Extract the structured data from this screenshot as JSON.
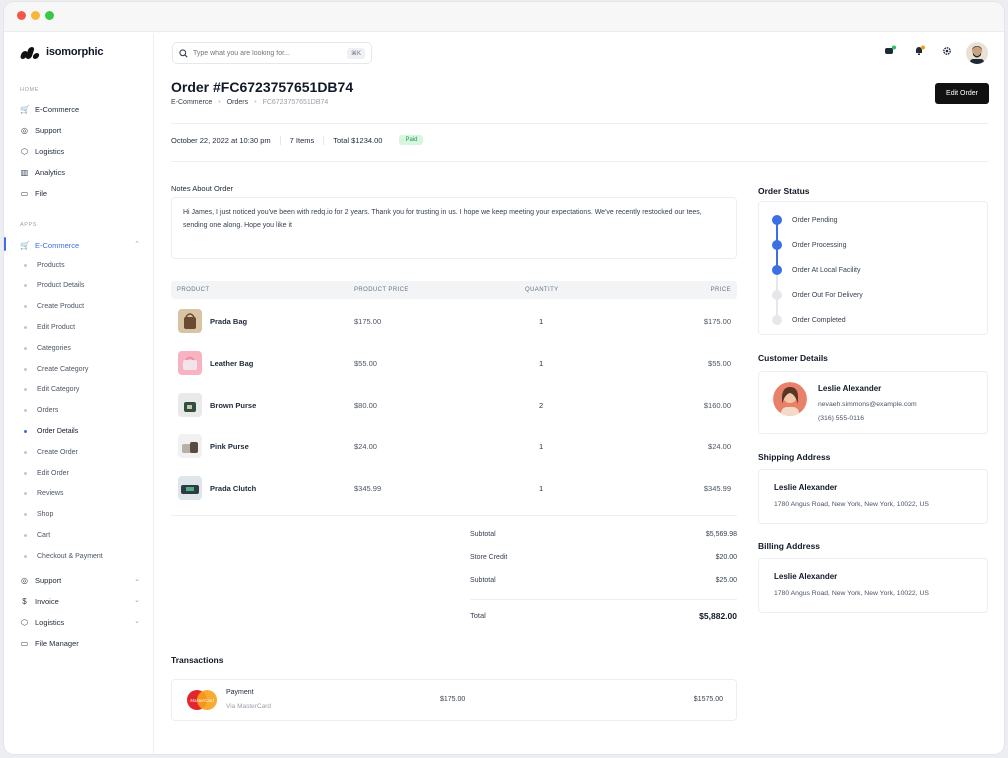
{
  "app": {
    "brand": "isomorphic"
  },
  "sidebar": {
    "home_label": "HOME",
    "home_items": [
      {
        "label": "E-Commerce",
        "icon": "cart-icon"
      },
      {
        "label": "Support",
        "icon": "headset-icon"
      },
      {
        "label": "Logistics",
        "icon": "box-icon"
      },
      {
        "label": "Analytics",
        "icon": "chart-icon"
      },
      {
        "label": "File",
        "icon": "file-icon"
      }
    ],
    "apps_label": "APPS",
    "apps_active": "E-Commerce",
    "sub_items": [
      "Products",
      "Product Details",
      "Create Product",
      "Edit Product",
      "Categories",
      "Create Category",
      "Edit Category",
      "Orders",
      "Order Details",
      "Create Order",
      "Edit Order",
      "Reviews",
      "Shop",
      "Cart",
      "Checkout & Payment"
    ],
    "active_sub": "Order Details",
    "more_items": [
      "Support",
      "Invoice",
      "Logistics",
      "File Manager"
    ]
  },
  "header": {
    "search_placeholder": "Type what you are looking for...",
    "search_shortcut": "⌘K"
  },
  "order": {
    "title": "Order #FC6723757651DB74",
    "breadcrumb": [
      "E-Commerce",
      "Orders",
      "FC6723757651DB74"
    ],
    "edit_label": "Edit Order",
    "date": "October 22, 2022 at 10:30 pm",
    "items_count": "7 Items",
    "total_meta": "Total $1234.00",
    "status_badge": "Paid",
    "notes_label": "Notes About Order",
    "notes": "Hi James, I just noticed you've been with redq.io for 2 years. Thank you for trusting in us. I hope we keep meeting your expectations. We've recently restocked our tees, sending one along. Hope you like it"
  },
  "table": {
    "headers": [
      "PRODUCT",
      "PRODUCT PRICE",
      "QUANTITY",
      "PRICE"
    ],
    "rows": [
      {
        "name": "Prada Bag",
        "price": "$175.00",
        "qty": "1",
        "total": "$175.00"
      },
      {
        "name": "Leather Bag",
        "price": "$55.00",
        "qty": "1",
        "total": "$55.00"
      },
      {
        "name": "Brown Purse",
        "price": "$80.00",
        "qty": "2",
        "total": "$160.00"
      },
      {
        "name": "Pink Purse",
        "price": "$24.00",
        "qty": "1",
        "total": "$24.00"
      },
      {
        "name": "Prada Clutch",
        "price": "$345.99",
        "qty": "1",
        "total": "$345.99"
      }
    ]
  },
  "totals": {
    "subtotal_label": "Subtotal",
    "subtotal": "$5,569.98",
    "credit_label": "Store Credit",
    "credit": "$20.00",
    "subtotal2_label": "Subtotal",
    "subtotal2": "$25.00",
    "total_label": "Total",
    "total": "$5,882.00"
  },
  "transactions": {
    "title": "Transactions",
    "card_brand": "MasterCard",
    "label": "Payment",
    "via": "Via MasterCard",
    "amount": "$175.00",
    "total": "$1575.00"
  },
  "status": {
    "title": "Order Status",
    "steps": [
      "Order Pending",
      "Order Processing",
      "Order At Local Facility",
      "Order Out For Delivery",
      "Order Completed"
    ],
    "completed_steps": 3
  },
  "customer": {
    "title": "Customer Details",
    "name": "Leslie Alexander",
    "email": "nevaeh.simmons@example.com",
    "phone": "(316) 555-0116"
  },
  "shipping": {
    "title": "Shipping Address",
    "name": "Leslie Alexander",
    "address": "1780 Angus Road, New York, New York, 10022, US"
  },
  "billing": {
    "title": "Billing Address",
    "name": "Leslie Alexander",
    "address": "1780 Angus Road, New York, New York, 10022, US"
  },
  "colors": {
    "accent": "#3b6fe3",
    "paid_bg": "#d7f5df",
    "paid_text": "#1f9d4d"
  }
}
